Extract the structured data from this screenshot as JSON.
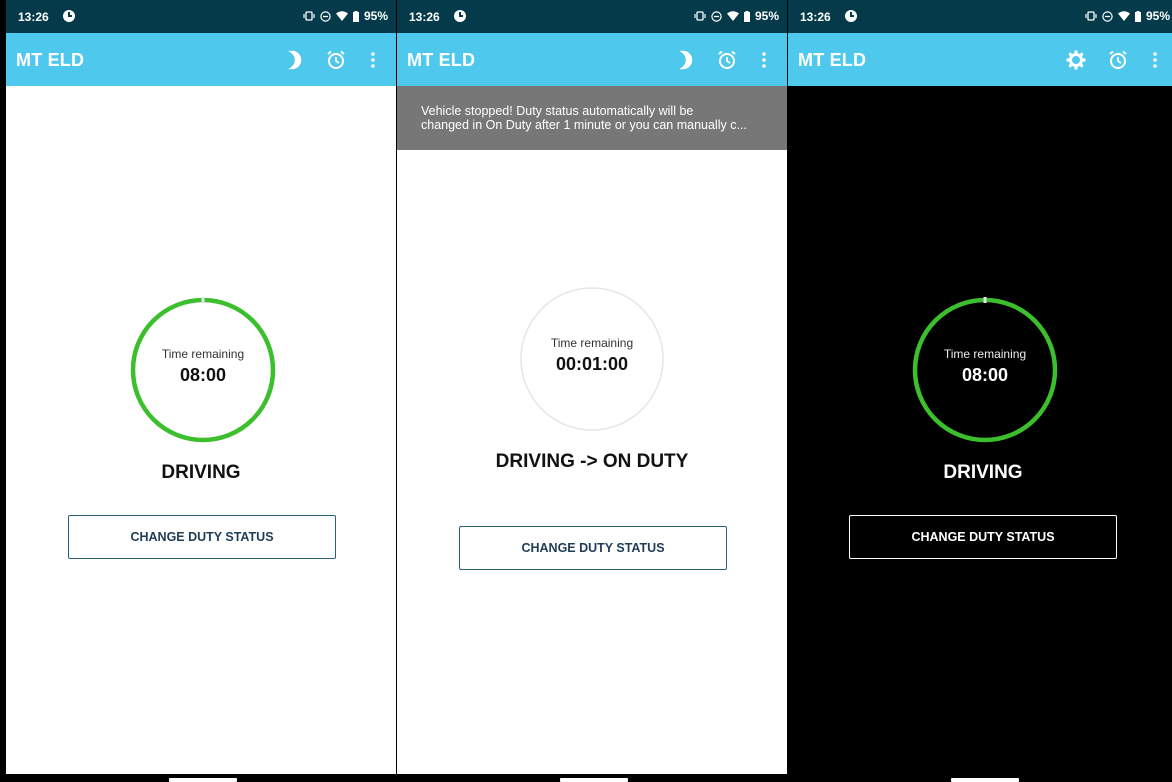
{
  "colors": {
    "status_bar": "#053a4a",
    "app_bar": "#4ec8ec",
    "ring_green": "#3cbf2d",
    "ring_gray": "#e6e6e6",
    "button_border": "#2b5d7c",
    "snackbar": "#777777"
  },
  "screens": [
    {
      "status_bar": {
        "time": "13:26",
        "battery": "95%"
      },
      "app_bar": {
        "title": "MT ELD",
        "icons": [
          "moon-icon",
          "alarm-icon",
          "more-vert-icon"
        ]
      },
      "timer": {
        "label": "Time remaining",
        "value": "08:00",
        "ring_color": "green"
      },
      "duty_status": "DRIVING",
      "button_label": "CHANGE DUTY STATUS",
      "theme": "light"
    },
    {
      "status_bar": {
        "time": "13:26",
        "battery": "95%"
      },
      "app_bar": {
        "title": "MT ELD",
        "icons": [
          "moon-icon",
          "alarm-icon",
          "more-vert-icon"
        ]
      },
      "snackbar": {
        "line1": "Vehicle stopped! Duty status automatically will be",
        "line2": "changed in On Duty after 1 minute or you can manually c..."
      },
      "timer": {
        "label": "Time remaining",
        "value": "00:01:00",
        "ring_color": "gray"
      },
      "duty_status": "DRIVING -> ON DUTY",
      "button_label": "CHANGE DUTY STATUS",
      "theme": "light"
    },
    {
      "status_bar": {
        "time": "13:26",
        "battery": "95%"
      },
      "app_bar": {
        "title": "MT ELD",
        "icons": [
          "sun-icon",
          "alarm-icon",
          "more-vert-icon"
        ]
      },
      "timer": {
        "label": "Time remaining",
        "value": "08:00",
        "ring_color": "green"
      },
      "duty_status": "DRIVING",
      "button_label": "CHANGE DUTY STATUS",
      "theme": "dark"
    }
  ]
}
